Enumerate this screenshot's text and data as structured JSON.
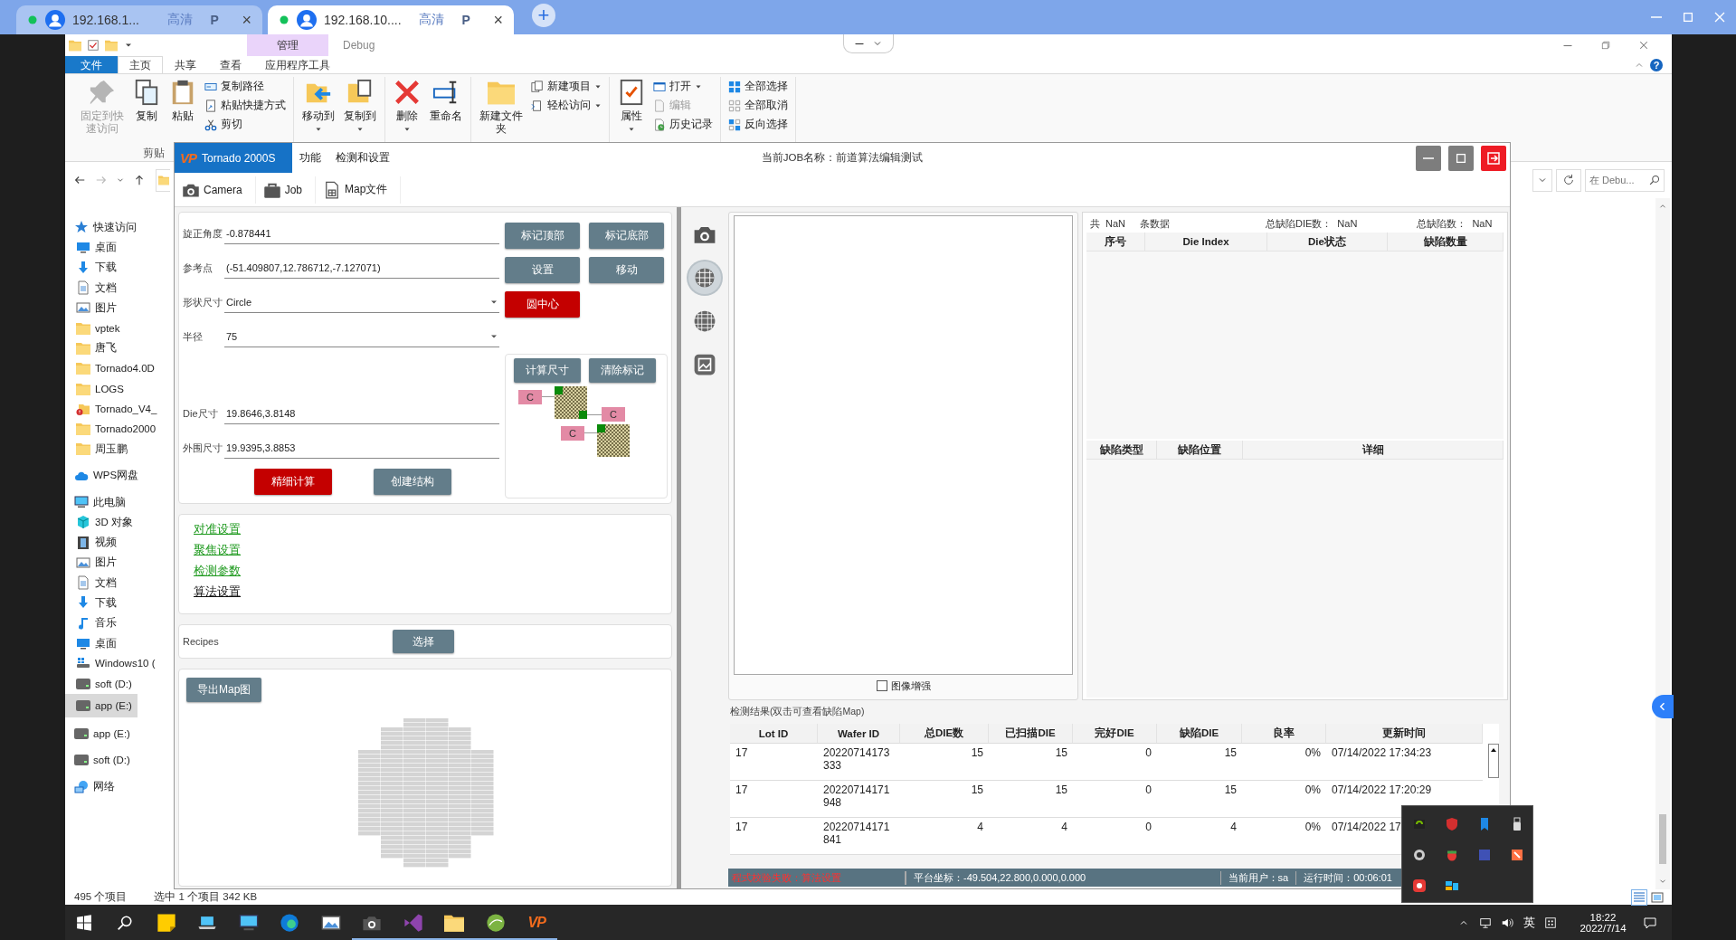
{
  "browser": {
    "tabs": [
      {
        "title": "192.168.1...",
        "quality": "高清",
        "badge": "P",
        "close": "×",
        "selected": false
      },
      {
        "title": "192.168.10....",
        "quality": "高清",
        "badge": "P",
        "close": "×",
        "selected": true
      }
    ],
    "new_tab": "+"
  },
  "explorer": {
    "context_tab": "管理",
    "title": "Debug",
    "help": "?",
    "ribbon_tabs": [
      {
        "label": "文件",
        "kind": "file",
        "selected": false
      },
      {
        "label": "主页",
        "kind": "normal",
        "selected": true
      },
      {
        "label": "共享",
        "kind": "normal",
        "selected": false
      },
      {
        "label": "查看",
        "kind": "normal",
        "selected": false
      },
      {
        "label": "应用程序工具",
        "kind": "normal",
        "selected": false
      }
    ],
    "ribbon_groups": [
      [
        {
          "label": "固定到快速访问",
          "kind": "large",
          "disabled": true,
          "menu": false
        },
        {
          "label": "复制",
          "kind": "large",
          "disabled": false,
          "menu": false
        },
        {
          "label": "粘贴",
          "kind": "large",
          "disabled": false,
          "menu": false
        },
        {
          "label": "复制路径",
          "kind": "small",
          "disabled": false,
          "menu": false
        },
        {
          "label": "粘贴快捷方式",
          "kind": "small",
          "disabled": false,
          "menu": false
        },
        {
          "label": "剪切",
          "kind": "small",
          "disabled": false,
          "menu": false
        }
      ],
      [
        {
          "label": "移动到",
          "kind": "large",
          "disabled": false,
          "menu": true
        },
        {
          "label": "复制到",
          "kind": "large",
          "disabled": false,
          "menu": true
        }
      ],
      [
        {
          "label": "删除",
          "kind": "large",
          "disabled": false,
          "menu": true
        },
        {
          "label": "重命名",
          "kind": "large",
          "disabled": false,
          "menu": false
        }
      ],
      [
        {
          "label": "新建文件夹",
          "kind": "large",
          "disabled": false,
          "menu": false
        },
        {
          "label": "新建项目",
          "kind": "small",
          "disabled": false,
          "menu": true
        },
        {
          "label": "轻松访问",
          "kind": "small",
          "disabled": false,
          "menu": true
        }
      ],
      [
        {
          "label": "属性",
          "kind": "large",
          "disabled": false,
          "menu": true
        },
        {
          "label": "打开",
          "kind": "small",
          "disabled": false,
          "menu": true
        },
        {
          "label": "编辑",
          "kind": "small",
          "disabled": true,
          "menu": false
        },
        {
          "label": "历史记录",
          "kind": "small",
          "disabled": false,
          "menu": false
        }
      ],
      [
        {
          "label": "全部选择",
          "kind": "small",
          "disabled": false,
          "menu": false
        },
        {
          "label": "全部取消",
          "kind": "small",
          "disabled": false,
          "menu": false
        },
        {
          "label": "反向选择",
          "kind": "small",
          "disabled": false,
          "menu": false
        }
      ]
    ],
    "group_label": "剪贴",
    "search": {
      "placeholder": "在 Debu..."
    },
    "nav": [
      {
        "label": "快速访问",
        "kind": "star",
        "selected": false,
        "children": [
          {
            "label": "桌面",
            "kind": "desktop",
            "selected": false
          },
          {
            "label": "下载",
            "kind": "download",
            "selected": false
          },
          {
            "label": "文档",
            "kind": "document",
            "selected": false
          },
          {
            "label": "图片",
            "kind": "picture",
            "selected": false
          },
          {
            "label": "vptek",
            "kind": "folder",
            "selected": false
          },
          {
            "label": "唐飞",
            "kind": "folder",
            "selected": false
          },
          {
            "label": "Tornado4.0D",
            "kind": "folder",
            "selected": false
          },
          {
            "label": "LOGS",
            "kind": "folder",
            "selected": false
          },
          {
            "label": "Tornado_V4_",
            "kind": "folder-alert",
            "selected": false
          },
          {
            "label": "Tornado2000",
            "kind": "folder",
            "selected": false
          },
          {
            "label": "周玉鹏",
            "kind": "folder",
            "selected": false
          }
        ]
      },
      {
        "label": "WPS网盘",
        "kind": "cloud",
        "selected": false
      },
      {
        "label": "此电脑",
        "kind": "computer",
        "selected": false,
        "children": [
          {
            "label": "3D 对象",
            "kind": "cube",
            "selected": false
          },
          {
            "label": "视频",
            "kind": "film",
            "selected": false
          },
          {
            "label": "图片",
            "kind": "picture",
            "selected": false
          },
          {
            "label": "文档",
            "kind": "document",
            "selected": false
          },
          {
            "label": "下载",
            "kind": "download",
            "selected": false
          },
          {
            "label": "音乐",
            "kind": "music",
            "selected": false
          },
          {
            "label": "桌面",
            "kind": "desktop",
            "selected": false
          },
          {
            "label": "Windows10 (",
            "kind": "windows-drive",
            "selected": false
          },
          {
            "label": "soft (D:)",
            "kind": "drive",
            "selected": false
          },
          {
            "label": "app (E:)",
            "kind": "drive",
            "selected": true
          }
        ]
      },
      {
        "label": "app (E:)",
        "kind": "drive",
        "selected": false
      },
      {
        "label": "soft (D:)",
        "kind": "drive",
        "selected": false
      },
      {
        "label": "网络",
        "kind": "network",
        "selected": false
      }
    ],
    "status": [
      "495 个项目",
      "选中 1 个项目 342 KB"
    ]
  },
  "app": {
    "logo": "VP",
    "menu_tabs": [
      {
        "label": "Tornado 2000S",
        "kind": "brand",
        "selected": true
      },
      {
        "label": "功能",
        "kind": "normal",
        "selected": false
      },
      {
        "label": "检测和设置",
        "kind": "normal",
        "selected": false
      }
    ],
    "job_title": "当前JOB名称：前道算法编辑测试",
    "toolbar": [
      {
        "label": "Camera",
        "kind": "camera"
      },
      {
        "label": "Job",
        "kind": "briefcase"
      },
      {
        "label": "Map文件",
        "kind": "sheet-file"
      }
    ],
    "fields": [
      {
        "label": "旋正角度",
        "value": "-0.878441",
        "kind": "text"
      },
      {
        "label": "参考点",
        "value": "(-51.409807,12.786712,-7.127071)",
        "kind": "text"
      },
      {
        "label": "形状尺寸",
        "value": "Circle",
        "kind": "select"
      },
      {
        "label": "半径",
        "value": "75",
        "kind": "select"
      },
      {
        "label": "Die尺寸",
        "value": "19.8646,3.8148",
        "kind": "text"
      },
      {
        "label": "外围尺寸",
        "value": "19.9395,3.8853",
        "kind": "text"
      }
    ],
    "actions": [
      {
        "label": "标记顶部",
        "kind": "normal"
      },
      {
        "label": "标记底部",
        "kind": "normal"
      },
      {
        "label": "设置",
        "kind": "normal"
      },
      {
        "label": "移动",
        "kind": "normal"
      },
      {
        "label": "圆中心",
        "kind": "danger"
      }
    ],
    "marker_actions": [
      {
        "label": "计算尺寸",
        "kind": "normal"
      },
      {
        "label": "清除标记",
        "kind": "normal"
      }
    ],
    "marker_labels": [
      "C",
      "C",
      "C"
    ],
    "bottom_actions": [
      {
        "label": "精细计算",
        "kind": "danger"
      },
      {
        "label": "创建结构",
        "kind": "normal"
      }
    ],
    "links": [
      {
        "label": "对准设置",
        "selected": false
      },
      {
        "label": "聚焦设置",
        "selected": false
      },
      {
        "label": "检测参数",
        "selected": false
      },
      {
        "label": "算法设置",
        "selected": true
      }
    ],
    "recipes": {
      "label": "Recipes",
      "button": "选择"
    },
    "export_button": "导出Map图",
    "side_tools": [
      {
        "kind": "camera",
        "selected": false
      },
      {
        "kind": "globe-grid",
        "selected": true
      },
      {
        "kind": "sphere-grid",
        "selected": false
      },
      {
        "kind": "picture-frame",
        "selected": false
      }
    ],
    "enhance": {
      "label": "图像增强",
      "checked": false
    },
    "summary": [
      {
        "text": "共",
        "kind": "label"
      },
      {
        "text": "NaN",
        "kind": "value"
      },
      {
        "text": "条数据",
        "kind": "label"
      },
      {
        "text": "总缺陷DIE数：",
        "kind": "label"
      },
      {
        "text": "NaN",
        "kind": "value"
      },
      {
        "text": "总缺陷数：",
        "kind": "label"
      },
      {
        "text": "NaN",
        "kind": "value"
      }
    ],
    "die_columns": [
      "序号",
      "Die Index",
      "Die状态",
      "缺陷数量"
    ],
    "defect_columns": [
      "缺陷类型",
      "缺陷位置",
      "详细"
    ],
    "results": {
      "title": "检测结果(双击可查看缺陷Map)",
      "columns": [
        "Lot ID",
        "Wafer ID",
        "总DIE数",
        "已扫描DIE",
        "完好DIE",
        "缺陷DIE",
        "良率",
        "更新时间"
      ],
      "rows": [
        [
          "17",
          "20220714173333",
          "15",
          "15",
          "0",
          "15",
          "0%",
          "07/14/2022 17:34:23"
        ],
        [
          "17",
          "20220714171948",
          "15",
          "15",
          "0",
          "15",
          "0%",
          "07/14/2022 17:20:29"
        ],
        [
          "17",
          "20220714171841",
          "4",
          "4",
          "0",
          "4",
          "0%",
          "07/14/2022 17"
        ]
      ]
    },
    "status_bar": {
      "error": "程式校验失败：算法设置",
      "coords": "平台坐标：-49.504,22.800,0.000,0.000",
      "user": "当前用户：sa",
      "runtime": "运行时间：00:06:01"
    }
  },
  "taskbar": {
    "apps": [
      {
        "kind": "sticky-note",
        "running": false
      },
      {
        "kind": "laptop",
        "running": false
      },
      {
        "kind": "computer",
        "running": false
      },
      {
        "kind": "browser",
        "running": false
      },
      {
        "kind": "picture",
        "running": false
      },
      {
        "kind": "camera",
        "running": true
      },
      {
        "kind": "bowtie",
        "running": true
      },
      {
        "kind": "folder",
        "running": true
      },
      {
        "kind": "ball",
        "running": true
      },
      {
        "kind": "text-logo",
        "label": "VP",
        "running": true
      }
    ],
    "ime": "英",
    "time": "18:22",
    "date": "2022/7/14"
  }
}
